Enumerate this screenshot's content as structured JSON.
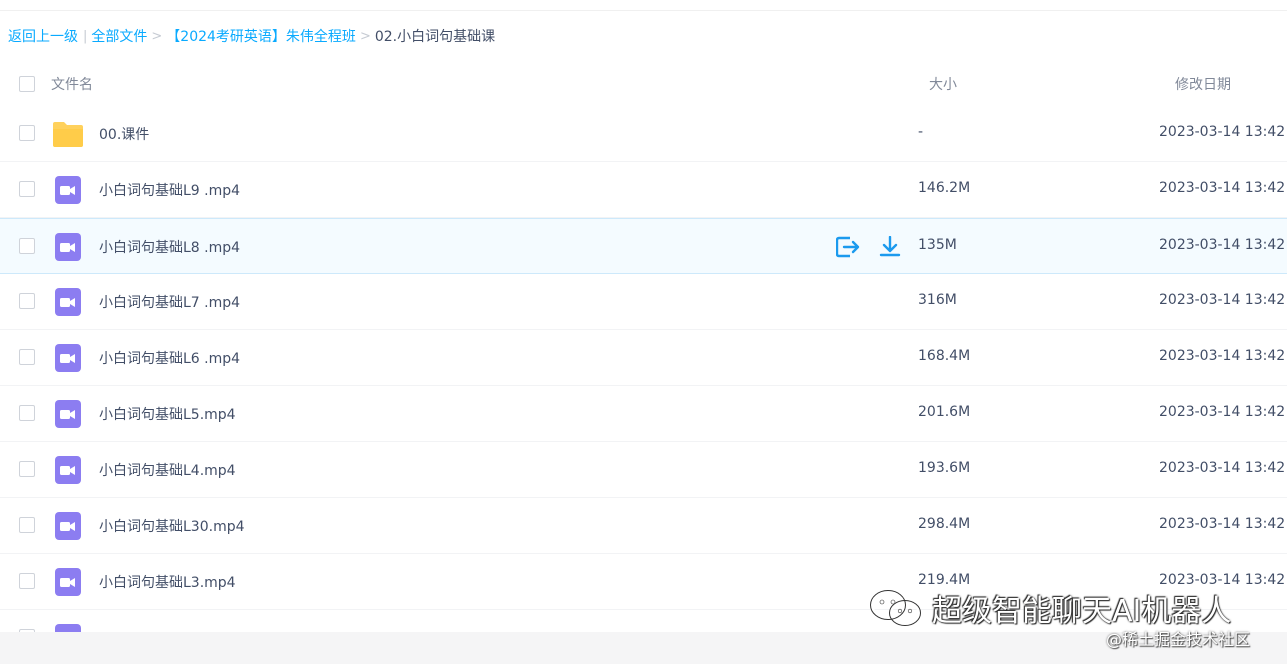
{
  "breadcrumb": {
    "back": "返回上一级",
    "all_files": "全部文件",
    "folder": "【2024考研英语】朱伟全程班",
    "current": "02.小白词句基础课"
  },
  "header": {
    "name": "文件名",
    "size": "大小",
    "date": "修改日期"
  },
  "files": [
    {
      "type": "folder",
      "name": "00.课件",
      "size": "-",
      "date": "2023-03-14 13:42"
    },
    {
      "type": "video",
      "name": "小白词句基础L9 .mp4",
      "size": "146.2M",
      "date": "2023-03-14 13:42"
    },
    {
      "type": "video",
      "name": "小白词句基础L8 .mp4",
      "size": "135M",
      "date": "2023-03-14 13:42",
      "hovered": true
    },
    {
      "type": "video",
      "name": "小白词句基础L7 .mp4",
      "size": "316M",
      "date": "2023-03-14 13:42"
    },
    {
      "type": "video",
      "name": "小白词句基础L6 .mp4",
      "size": "168.4M",
      "date": "2023-03-14 13:42"
    },
    {
      "type": "video",
      "name": "小白词句基础L5.mp4",
      "size": "201.6M",
      "date": "2023-03-14 13:42"
    },
    {
      "type": "video",
      "name": "小白词句基础L4.mp4",
      "size": "193.6M",
      "date": "2023-03-14 13:42"
    },
    {
      "type": "video",
      "name": "小白词句基础L30.mp4",
      "size": "298.4M",
      "date": "2023-03-14 13:42"
    },
    {
      "type": "video",
      "name": "小白词句基础L3.mp4",
      "size": "219.4M",
      "date": "2023-03-14 13:42"
    },
    {
      "type": "video",
      "name": "",
      "size": "",
      "date": ""
    }
  ],
  "row_actions": [
    "share-icon",
    "download-icon"
  ],
  "colors": {
    "link": "#09aaff",
    "folder": "#ffd15c",
    "video": "#8c7df1",
    "action": "#1b9aee"
  },
  "watermark": {
    "main": "超级智能聊天AI机器人",
    "sub": "@稀土掘金技术社区"
  }
}
